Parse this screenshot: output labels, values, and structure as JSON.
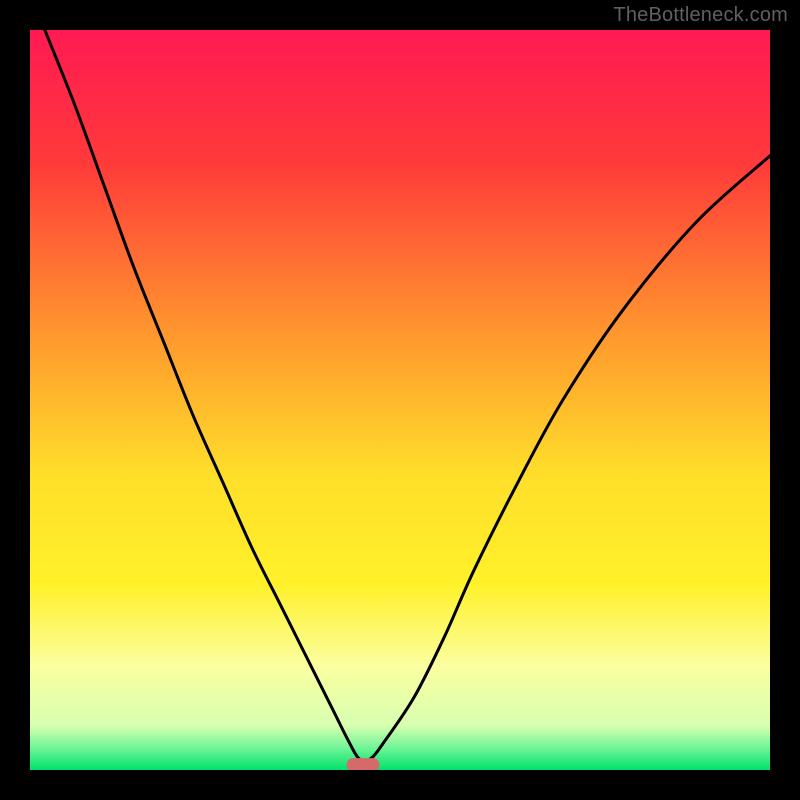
{
  "watermark": "TheBottleneck.com",
  "chart_data": {
    "type": "line",
    "title": "",
    "xlabel": "",
    "ylabel": "",
    "xlim": [
      0,
      100
    ],
    "ylim": [
      0,
      100
    ],
    "gradient_stops": [
      {
        "offset": 0,
        "color": "#ff1a53"
      },
      {
        "offset": 18,
        "color": "#ff3a3a"
      },
      {
        "offset": 40,
        "color": "#ff932e"
      },
      {
        "offset": 60,
        "color": "#ffde2a"
      },
      {
        "offset": 75,
        "color": "#fff12a"
      },
      {
        "offset": 86,
        "color": "#fbffa0"
      },
      {
        "offset": 94,
        "color": "#d7ffb0"
      },
      {
        "offset": 97,
        "color": "#70f597"
      },
      {
        "offset": 100,
        "color": "#00e26a"
      }
    ],
    "series": [
      {
        "name": "bottleneck-curve",
        "color": "#000000",
        "x": [
          2,
          6,
          10,
          14,
          18,
          22,
          26,
          30,
          34,
          38,
          41,
          43,
          44.5,
          46,
          48,
          52,
          56,
          60,
          66,
          72,
          80,
          90,
          100
        ],
        "y": [
          100,
          90,
          79,
          68,
          58,
          48,
          39,
          30,
          22,
          14,
          8,
          4,
          1.5,
          1.5,
          4,
          10,
          18,
          27,
          39,
          50,
          62,
          74,
          83
        ]
      }
    ],
    "marker": {
      "name": "optimal-zone-marker",
      "x_center": 45,
      "x_half_width": 2.2,
      "y": 0.8,
      "color": "#d66a6a",
      "rx": 6
    }
  }
}
